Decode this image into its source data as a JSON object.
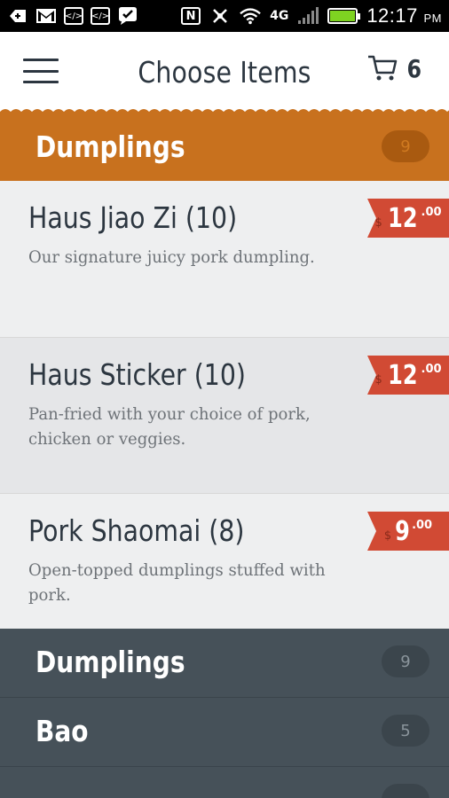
{
  "status_bar": {
    "time": "12:17",
    "ampm": "PM",
    "network": "4G",
    "icons": [
      "plus-icon",
      "gmail-icon",
      "code-icon",
      "code-icon",
      "check-icon",
      "nfc-icon",
      "mute-icon",
      "wifi-icon",
      "signal-icon",
      "battery-icon"
    ]
  },
  "header": {
    "title": "Choose Items",
    "cart_count": "6"
  },
  "category": {
    "name": "Dumplings",
    "count": "9",
    "color": "#c8711e"
  },
  "items": [
    {
      "name": "Haus Jiao Zi (10)",
      "description": "Our signature juicy pork dumpling.",
      "price_currency": "$",
      "price_whole": "12",
      "price_cents": ".00"
    },
    {
      "name": "Haus Sticker (10)",
      "description": "Pan-fried with your choice of pork, chicken or veggies.",
      "price_currency": "$",
      "price_whole": "12",
      "price_cents": ".00"
    },
    {
      "name": "Pork Shaomai (8)",
      "description": "Open-topped dumplings stuffed with pork.",
      "price_currency": "$",
      "price_whole": "9",
      "price_cents": ".00"
    }
  ],
  "drawer": {
    "items": [
      {
        "name": "Dumplings",
        "count": "9"
      },
      {
        "name": "Bao",
        "count": "5"
      },
      {
        "name": "",
        "count": ""
      }
    ]
  },
  "colors": {
    "accent": "#c8711e",
    "price_tag": "#d14a34",
    "drawer_bg": "#465159",
    "text_dark": "#2c3640"
  }
}
